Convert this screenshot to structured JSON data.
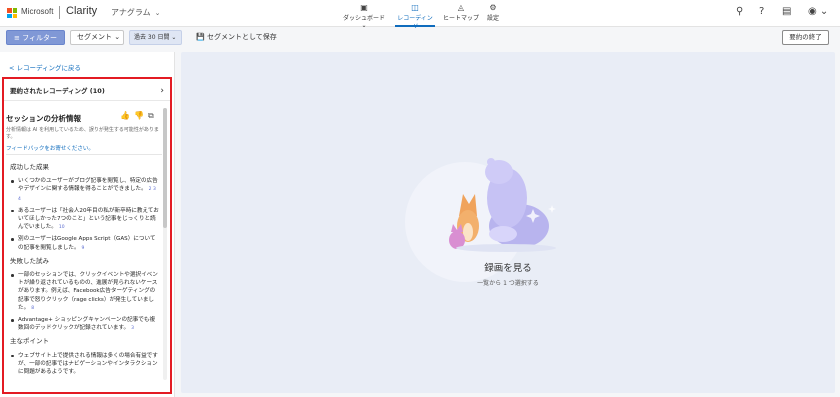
{
  "header": {
    "brand": "Microsoft",
    "product": "Clarity",
    "project": "アナグラム",
    "project_chevron": "⌄",
    "tabs": [
      {
        "icon": "dashboard-icon",
        "glyph": "▣",
        "label": "ダッシュボード ⌄"
      },
      {
        "icon": "recording-icon",
        "glyph": "◫",
        "label": "レコーディング"
      },
      {
        "icon": "heatmap-icon",
        "glyph": "◬",
        "label": "ヒートマップ"
      },
      {
        "icon": "gear-icon",
        "glyph": "⚙",
        "label": "設定"
      }
    ],
    "right_icons": {
      "share": "⚲",
      "help": "?",
      "doc": "▤",
      "account": "◉ ⌄"
    }
  },
  "filterbar": {
    "filter_label": "≡ フィルター",
    "segment_label": "セグメント ⌄",
    "date_label": "過去 30 日間 ⌄",
    "save_label": "セグメントとして保存",
    "end_summary_label": "要約の終了"
  },
  "sidebar": {
    "back_link": "< レコーディングに戻る",
    "summary_row": "要約されたレコーディング (10)",
    "insight_title": "セッションの分析情報",
    "insight_icons": "👍 👎 ⧉",
    "disclaimer": "分析情報は AI を利用しているため、誤りが発生する可能性があります。",
    "feedback": "フィードバックをお寄せください。",
    "sections": {
      "success": {
        "title": "成功した成果",
        "items": [
          {
            "text": "いくつかのユーザーがブログ記事を閲覧し、特定の広告やデザインに関する情報を得ることができました。",
            "refs": "2 3 4"
          },
          {
            "text": "あるユーザーは「社会人20年目の私が新卒時に教えておいてほしかった7つのこと」という記事をじっくりと読んでいました。",
            "refs": "10"
          },
          {
            "text": "別のユーザーはGoogle Apps Script（GAS）についての記事を閲覧しました。",
            "refs": "9"
          }
        ]
      },
      "failed": {
        "title": "失敗した試み",
        "items": [
          {
            "text": "一部のセッションでは、クリックイベントや選択イベントが繰り返されているものの、進展が見られないケースがあります。例えば、Facebook広告ターゲティングの記事で怒りクリック（rage clicks）が発生していました。",
            "refs": "8"
          },
          {
            "text": "Advantage+ ショッピングキャンペーンの記事でも複数回のデッドクリックが記録されています。",
            "refs": "3"
          }
        ]
      },
      "points": {
        "title": "主なポイント",
        "items": [
          {
            "text": "ウェブサイト上で提供される情報は多くの場合有益ですが、一部の記事ではナビゲーションやインタラクションに問題があるようです。",
            "refs": ""
          }
        ]
      }
    }
  },
  "main": {
    "title": "録画を見る",
    "subtitle": "一覧から 1 つ選択する"
  },
  "colors": {
    "accent": "#0f6cbd",
    "highlight": "#e31b23",
    "filter_button": "#8098d6"
  }
}
